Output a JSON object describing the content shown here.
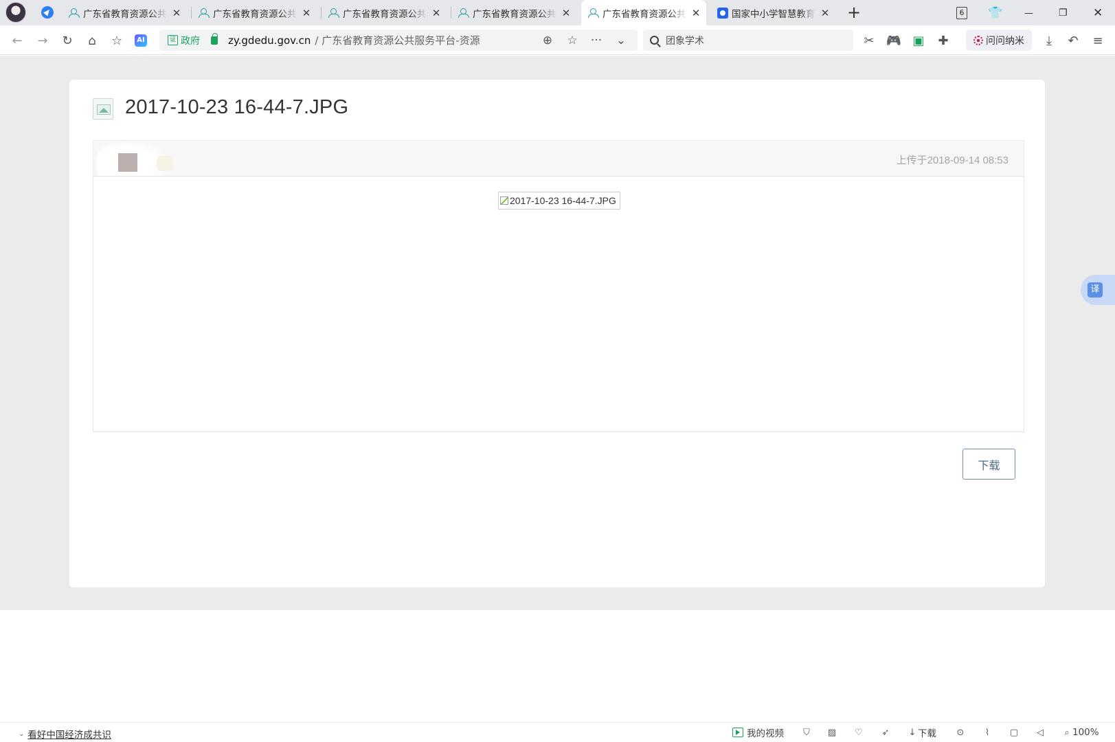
{
  "browser": {
    "tabs": [
      {
        "label": "广东省教育资源公共服务平台",
        "icon": "people-icon",
        "active": false
      },
      {
        "label": "广东省教育资源公共服务平台",
        "icon": "people-icon",
        "active": false
      },
      {
        "label": "广东省教育资源公共服务平台",
        "icon": "people-icon",
        "active": false
      },
      {
        "label": "广东省教育资源公共服务平台",
        "icon": "people-icon",
        "active": false
      },
      {
        "label": "广东省教育资源公共服务平台",
        "icon": "people-icon",
        "active": true
      },
      {
        "label": "国家中小学智慧教育平台",
        "icon": "blue-app-icon",
        "active": false
      }
    ],
    "tab_close": "✕",
    "new_tab": "+",
    "tab_count": "6",
    "window": {
      "minimize": "—",
      "restore": "❐",
      "close": "✕"
    }
  },
  "toolbar": {
    "ai_label": "AI",
    "gov_badge": "政府",
    "gov_icon": "证",
    "url_domain": "zy.gdedu.gov.cn",
    "url_rest": "/ 广东省教育资源公共服务平台-资源",
    "search_value": "团象学术",
    "wenwen_label": "问问纳米"
  },
  "page": {
    "file_title": "2017-10-23 16-44-7.JPG",
    "upload_time": "上传于2018-09-14 08:53",
    "image_alt": "2017-10-23 16-44-7.JPG",
    "download_label": "下载",
    "translate_label": "译"
  },
  "statusbar": {
    "news": "看好中国经济成共识",
    "my_video": "我的视频",
    "download": "下载",
    "zoom": "100%"
  },
  "colors": {
    "accent_green": "#1aa35a",
    "tab_bg": "#e5e7ea",
    "page_bg": "#ebebeb",
    "button_border": "#6f8fb0"
  }
}
